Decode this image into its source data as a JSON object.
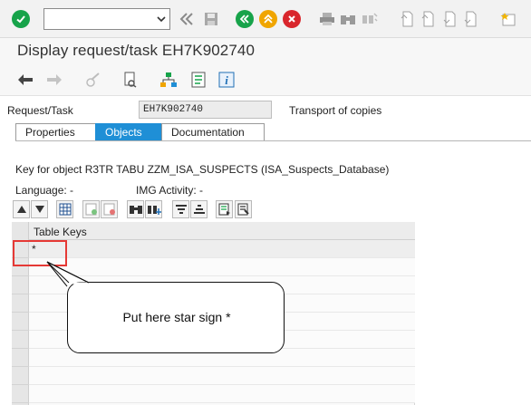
{
  "toolbar": {
    "command_field_value": "",
    "icons": [
      "enter-icon",
      "command-field",
      "back-double-icon",
      "save-icon",
      "back-icon",
      "exit-icon",
      "cancel-icon",
      "print-icon",
      "find-icon",
      "find-next-icon",
      "first-page-icon",
      "previous-page-icon",
      "next-page-icon",
      "last-page-icon",
      "create-session-icon"
    ]
  },
  "page": {
    "title": "Display request/task EH7K902740"
  },
  "apptoolbar": {
    "icons": [
      "back-arrow-icon",
      "forward-arrow-icon",
      "display-change-icon",
      "check-icon",
      "object-list-icon",
      "hierarchy-icon",
      "info-icon"
    ]
  },
  "fields": {
    "request_task_label": "Request/Task",
    "request_task_value": "EH7K902740",
    "request_type": "Transport of copies"
  },
  "tabs": [
    {
      "label": "Properties",
      "active": false
    },
    {
      "label": "Objects",
      "active": true
    },
    {
      "label": "Documentation",
      "active": false
    }
  ],
  "keys": {
    "key_for_object": "Key for object R3TR TABU ZZM_ISA_SUSPECTS (ISA_Suspects_Database)",
    "language": "Language: -",
    "img_activity": "IMG Activity: -"
  },
  "table": {
    "column_header": "Table Keys",
    "rows": [
      "*",
      "",
      "",
      "",
      "",
      "",
      "",
      "",
      "",
      ""
    ]
  },
  "annotation": {
    "callout_text": "Put here star sign *"
  },
  "colors": {
    "accent_blue": "#1f8fd6",
    "green": "#17a34a",
    "orange": "#f0a500",
    "red": "#d9262c",
    "highlight_red": "#e53935"
  }
}
